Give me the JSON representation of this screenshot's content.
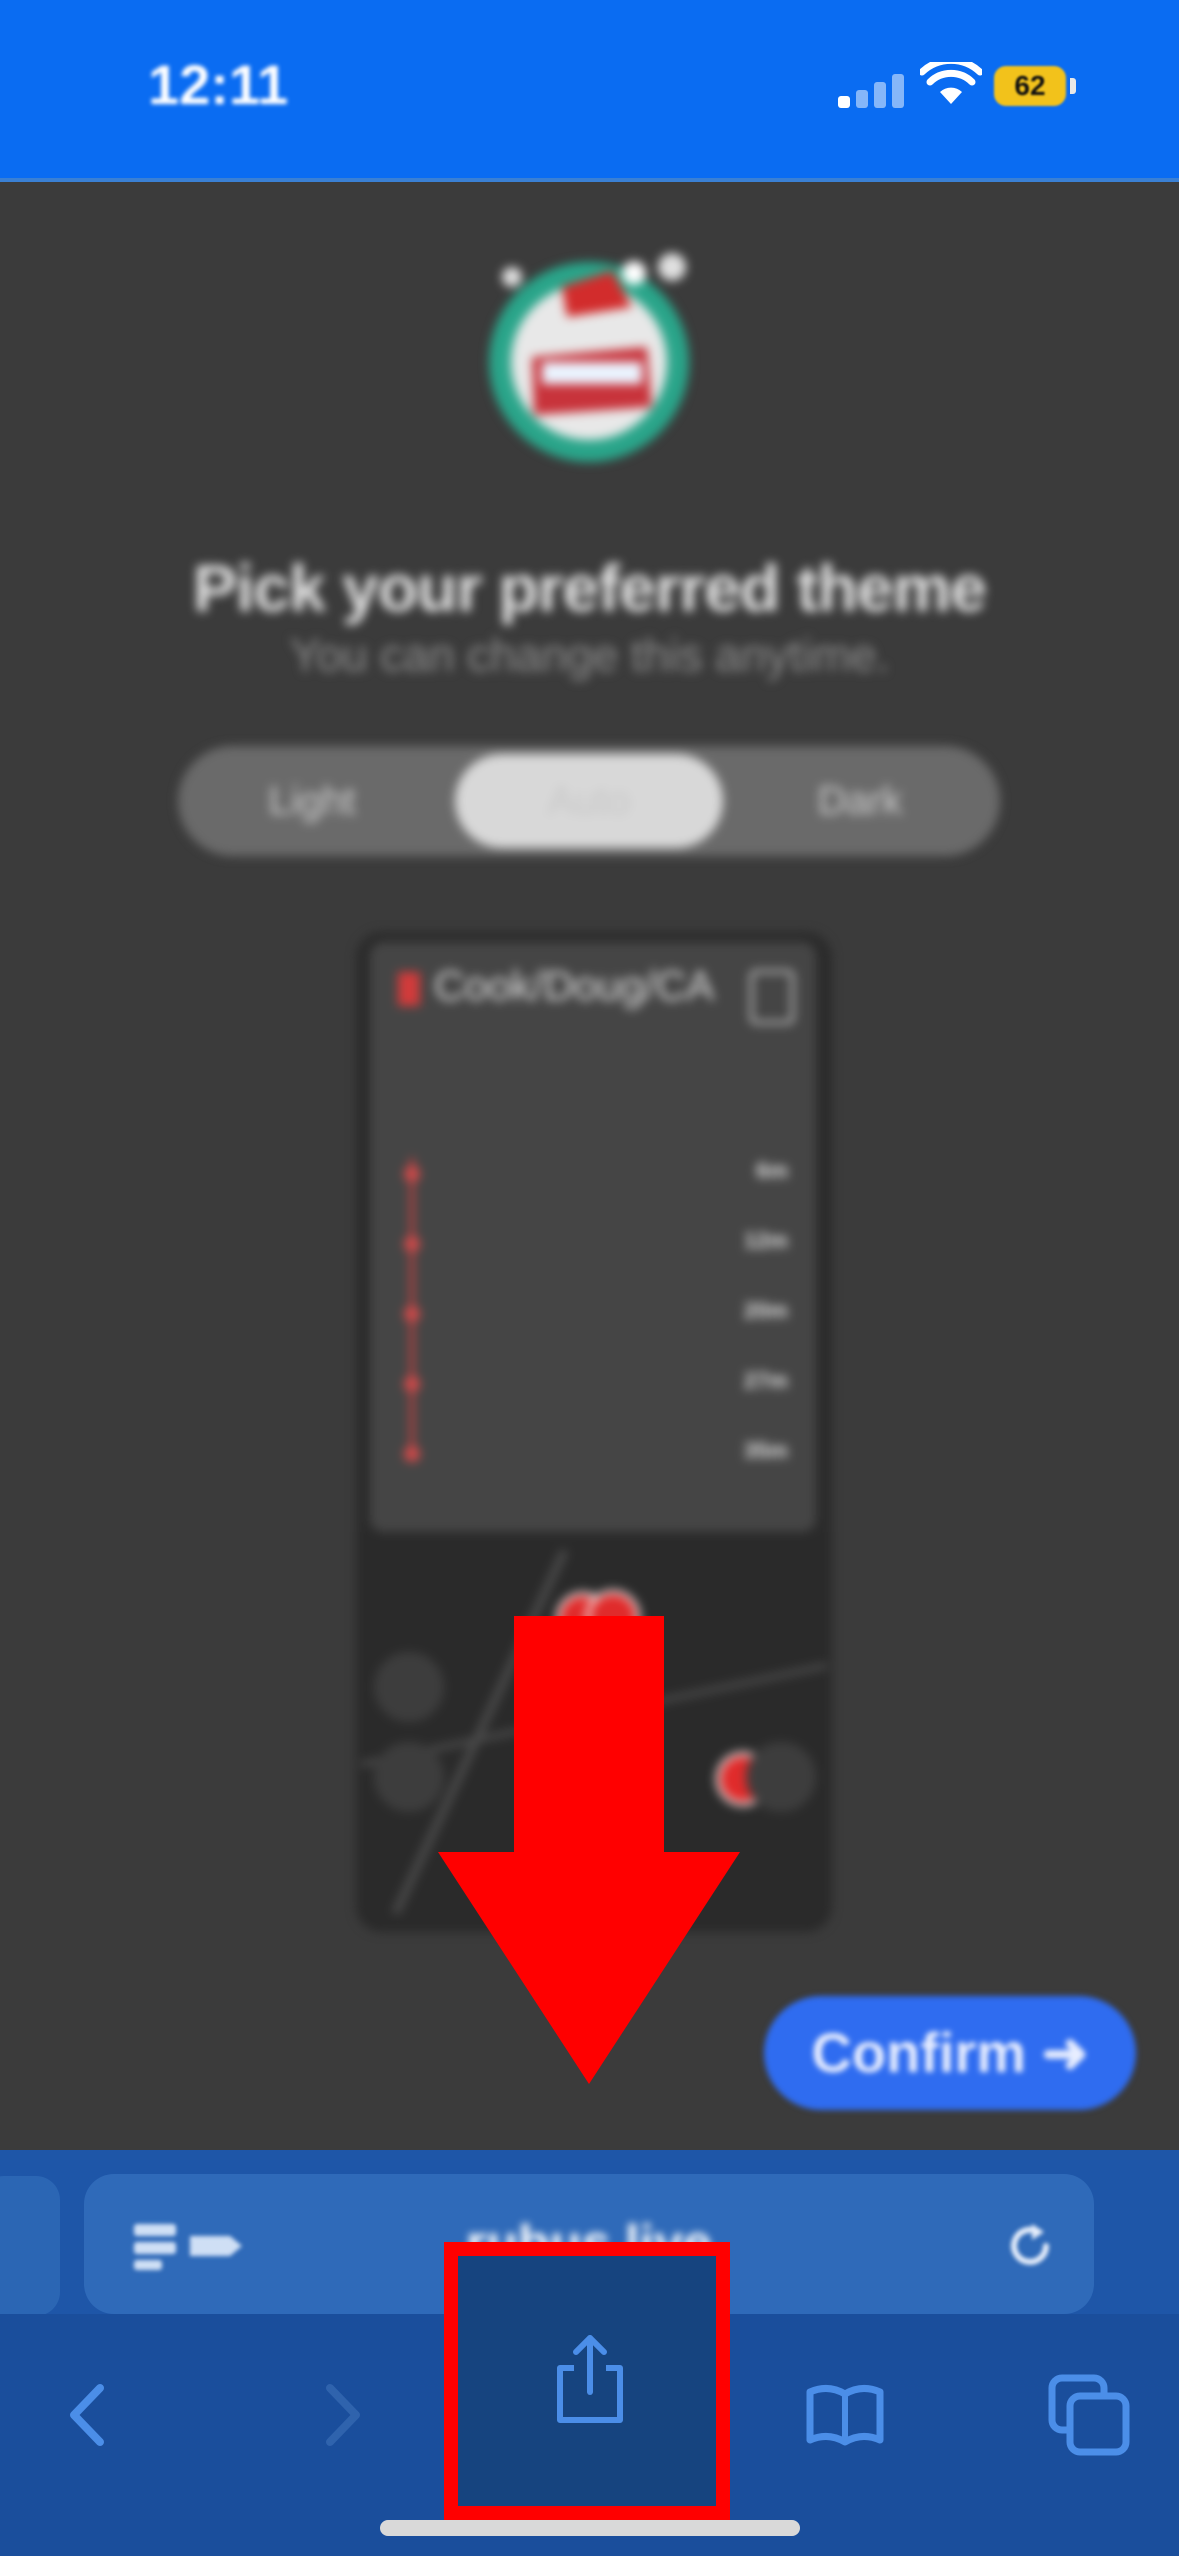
{
  "status_bar": {
    "time": "12:11",
    "battery": "62",
    "background": "#0a6cf2"
  },
  "onboarding": {
    "title": "Pick your preferred theme",
    "subtitle": "You can change this anytime.",
    "theme_options": [
      "Light",
      "Auto",
      "Dark"
    ],
    "selected_theme": "Auto",
    "confirm_label": "Confirm ➜"
  },
  "preview": {
    "route_name": "Cook/Doug/CA",
    "stops": [
      {
        "eta": "6m"
      },
      {
        "eta": "12m"
      },
      {
        "eta": "20m"
      },
      {
        "eta": "27m"
      },
      {
        "eta": "35m"
      }
    ]
  },
  "browser": {
    "url": "rubus.live"
  },
  "annotation": {
    "arrow_color": "#ff0000",
    "highlight_target": "share-button"
  }
}
